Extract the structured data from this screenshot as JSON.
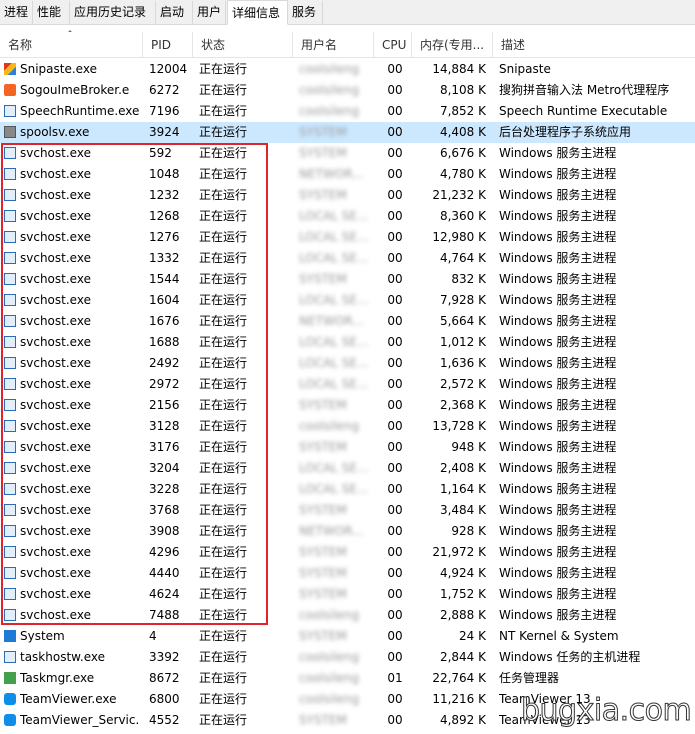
{
  "tabs": [
    "进程",
    "性能",
    "应用历史记录",
    "启动",
    "用户",
    "详细信息",
    "服务"
  ],
  "active_tab_index": 5,
  "columns": {
    "name": "名称",
    "pid": "PID",
    "status": "状态",
    "user": "用户名",
    "cpu": "CPU",
    "mem": "内存(专用...",
    "desc": "描述"
  },
  "rows": [
    {
      "icon": "snipaste-icon",
      "name": "Snipaste.exe",
      "pid": "12004",
      "status": "正在运行",
      "user": "coolsileng",
      "cpu": "00",
      "mem": "14,884 K",
      "desc": "Snipaste"
    },
    {
      "icon": "sogou-icon",
      "name": "SogouImeBroker.e",
      "pid": "6272",
      "status": "正在运行",
      "user": "coolsileng",
      "cpu": "00",
      "mem": "8,108 K",
      "desc": "搜狗拼音输入法 Metro代理程序"
    },
    {
      "icon": "generic-exe-icon",
      "name": "SpeechRuntime.exe",
      "pid": "7196",
      "status": "正在运行",
      "user": "coolsileng",
      "cpu": "00",
      "mem": "7,852 K",
      "desc": "Speech Runtime Executable"
    },
    {
      "icon": "printer-icon",
      "name": "spoolsv.exe",
      "pid": "3924",
      "status": "正在运行",
      "user": "SYSTEM",
      "cpu": "00",
      "mem": "4,408 K",
      "desc": "后台处理程序子系统应用",
      "selected": true
    },
    {
      "icon": "generic-exe-icon",
      "name": "svchost.exe",
      "pid": "592",
      "status": "正在运行",
      "user": "SYSTEM",
      "cpu": "00",
      "mem": "6,676 K",
      "desc": "Windows 服务主进程"
    },
    {
      "icon": "generic-exe-icon",
      "name": "svchost.exe",
      "pid": "1048",
      "status": "正在运行",
      "user": "NETWOR...",
      "cpu": "00",
      "mem": "4,780 K",
      "desc": "Windows 服务主进程"
    },
    {
      "icon": "generic-exe-icon",
      "name": "svchost.exe",
      "pid": "1232",
      "status": "正在运行",
      "user": "SYSTEM",
      "cpu": "00",
      "mem": "21,232 K",
      "desc": "Windows 服务主进程"
    },
    {
      "icon": "generic-exe-icon",
      "name": "svchost.exe",
      "pid": "1268",
      "status": "正在运行",
      "user": "LOCAL SE...",
      "cpu": "00",
      "mem": "8,360 K",
      "desc": "Windows 服务主进程"
    },
    {
      "icon": "generic-exe-icon",
      "name": "svchost.exe",
      "pid": "1276",
      "status": "正在运行",
      "user": "LOCAL SE...",
      "cpu": "00",
      "mem": "12,980 K",
      "desc": "Windows 服务主进程"
    },
    {
      "icon": "generic-exe-icon",
      "name": "svchost.exe",
      "pid": "1332",
      "status": "正在运行",
      "user": "LOCAL SE...",
      "cpu": "00",
      "mem": "4,764 K",
      "desc": "Windows 服务主进程"
    },
    {
      "icon": "generic-exe-icon",
      "name": "svchost.exe",
      "pid": "1544",
      "status": "正在运行",
      "user": "SYSTEM",
      "cpu": "00",
      "mem": "832 K",
      "desc": "Windows 服务主进程"
    },
    {
      "icon": "generic-exe-icon",
      "name": "svchost.exe",
      "pid": "1604",
      "status": "正在运行",
      "user": "LOCAL SE...",
      "cpu": "00",
      "mem": "7,928 K",
      "desc": "Windows 服务主进程"
    },
    {
      "icon": "generic-exe-icon",
      "name": "svchost.exe",
      "pid": "1676",
      "status": "正在运行",
      "user": "NETWOR...",
      "cpu": "00",
      "mem": "5,664 K",
      "desc": "Windows 服务主进程"
    },
    {
      "icon": "generic-exe-icon",
      "name": "svchost.exe",
      "pid": "1688",
      "status": "正在运行",
      "user": "LOCAL SE...",
      "cpu": "00",
      "mem": "1,012 K",
      "desc": "Windows 服务主进程"
    },
    {
      "icon": "generic-exe-icon",
      "name": "svchost.exe",
      "pid": "2492",
      "status": "正在运行",
      "user": "LOCAL SE...",
      "cpu": "00",
      "mem": "1,636 K",
      "desc": "Windows 服务主进程"
    },
    {
      "icon": "generic-exe-icon",
      "name": "svchost.exe",
      "pid": "2972",
      "status": "正在运行",
      "user": "LOCAL SE...",
      "cpu": "00",
      "mem": "2,572 K",
      "desc": "Windows 服务主进程"
    },
    {
      "icon": "generic-exe-icon",
      "name": "svchost.exe",
      "pid": "2156",
      "status": "正在运行",
      "user": "SYSTEM",
      "cpu": "00",
      "mem": "2,368 K",
      "desc": "Windows 服务主进程"
    },
    {
      "icon": "generic-exe-icon",
      "name": "svchost.exe",
      "pid": "3128",
      "status": "正在运行",
      "user": "coolsileng",
      "cpu": "00",
      "mem": "13,728 K",
      "desc": "Windows 服务主进程"
    },
    {
      "icon": "generic-exe-icon",
      "name": "svchost.exe",
      "pid": "3176",
      "status": "正在运行",
      "user": "SYSTEM",
      "cpu": "00",
      "mem": "948 K",
      "desc": "Windows 服务主进程"
    },
    {
      "icon": "generic-exe-icon",
      "name": "svchost.exe",
      "pid": "3204",
      "status": "正在运行",
      "user": "LOCAL SE...",
      "cpu": "00",
      "mem": "2,408 K",
      "desc": "Windows 服务主进程"
    },
    {
      "icon": "generic-exe-icon",
      "name": "svchost.exe",
      "pid": "3228",
      "status": "正在运行",
      "user": "LOCAL SE...",
      "cpu": "00",
      "mem": "1,164 K",
      "desc": "Windows 服务主进程"
    },
    {
      "icon": "generic-exe-icon",
      "name": "svchost.exe",
      "pid": "3768",
      "status": "正在运行",
      "user": "SYSTEM",
      "cpu": "00",
      "mem": "3,484 K",
      "desc": "Windows 服务主进程"
    },
    {
      "icon": "generic-exe-icon",
      "name": "svchost.exe",
      "pid": "3908",
      "status": "正在运行",
      "user": "NETWOR...",
      "cpu": "00",
      "mem": "928 K",
      "desc": "Windows 服务主进程"
    },
    {
      "icon": "generic-exe-icon",
      "name": "svchost.exe",
      "pid": "4296",
      "status": "正在运行",
      "user": "SYSTEM",
      "cpu": "00",
      "mem": "21,972 K",
      "desc": "Windows 服务主进程"
    },
    {
      "icon": "generic-exe-icon",
      "name": "svchost.exe",
      "pid": "4440",
      "status": "正在运行",
      "user": "SYSTEM",
      "cpu": "00",
      "mem": "4,924 K",
      "desc": "Windows 服务主进程"
    },
    {
      "icon": "generic-exe-icon",
      "name": "svchost.exe",
      "pid": "4624",
      "status": "正在运行",
      "user": "SYSTEM",
      "cpu": "00",
      "mem": "1,752 K",
      "desc": "Windows 服务主进程"
    },
    {
      "icon": "generic-exe-icon",
      "name": "svchost.exe",
      "pid": "7488",
      "status": "正在运行",
      "user": "coolsileng",
      "cpu": "00",
      "mem": "2,888 K",
      "desc": "Windows 服务主进程"
    },
    {
      "icon": "windows-icon",
      "name": "System",
      "pid": "4",
      "status": "正在运行",
      "user": "SYSTEM",
      "cpu": "00",
      "mem": "24 K",
      "desc": "NT Kernel & System"
    },
    {
      "icon": "generic-exe-icon",
      "name": "taskhostw.exe",
      "pid": "3392",
      "status": "正在运行",
      "user": "coolsileng",
      "cpu": "00",
      "mem": "2,844 K",
      "desc": "Windows 任务的主机进程"
    },
    {
      "icon": "taskmgr-icon",
      "name": "Taskmgr.exe",
      "pid": "8672",
      "status": "正在运行",
      "user": "coolsileng",
      "cpu": "01",
      "mem": "22,764 K",
      "desc": "任务管理器"
    },
    {
      "icon": "teamviewer-icon",
      "name": "TeamViewer.exe",
      "pid": "6800",
      "status": "正在运行",
      "user": "coolsileng",
      "cpu": "00",
      "mem": "11,216 K",
      "desc": "TeamViewer 13"
    },
    {
      "icon": "teamviewer-icon",
      "name": "TeamViewer_Servic...",
      "pid": "4552",
      "status": "正在运行",
      "user": "SYSTEM",
      "cpu": "00",
      "mem": "4,892 K",
      "desc": "TeamViewer 13"
    }
  ],
  "watermark": "bugxia.com",
  "highlight_color": "#e0242c",
  "selection_color": "#cce8ff"
}
